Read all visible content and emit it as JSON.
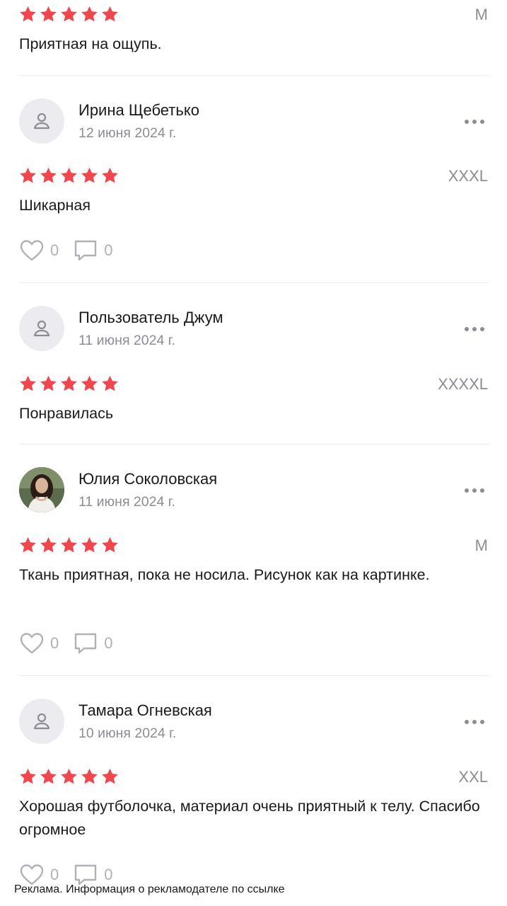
{
  "top": {
    "rating": 5,
    "size": "M",
    "text": "Приятная на ощупь."
  },
  "reviews": [
    {
      "author": "Ирина Щебетько",
      "date": "12 июня 2024 г.",
      "rating": 5,
      "size": "XXXL",
      "text": "Шикарная",
      "likes": "0",
      "comments": "0",
      "avatar": "placeholder"
    },
    {
      "author": "Пользователь Джум",
      "date": "11 июня 2024 г.",
      "rating": 5,
      "size": "XXXXL",
      "text": "Понравилась",
      "avatar": "placeholder"
    },
    {
      "author": "Юлия Соколовская",
      "date": "11 июня 2024 г.",
      "rating": 5,
      "size": "M",
      "text": "Ткань приятная, пока не носила. Рисунок как на картинке.",
      "likes": "0",
      "comments": "0",
      "avatar": "photo"
    },
    {
      "author": "Тамара Огневская",
      "date": "10 июня 2024 г.",
      "rating": 5,
      "size": "XXL",
      "text": "Хорошая футболочка, материал очень приятный к телу. Спасибо огромное",
      "likes": "0",
      "comments": "0",
      "avatar": "placeholder"
    }
  ],
  "footer": {
    "ad_note": "Реклама. Информация о рекламодателе по ссылке"
  },
  "colors": {
    "star": "#f0464d",
    "muted": "#8c8c96",
    "divider": "#ececef"
  },
  "icons": [
    "star-icon",
    "user-placeholder-icon",
    "more-dots-icon",
    "heart-icon",
    "comment-icon"
  ]
}
